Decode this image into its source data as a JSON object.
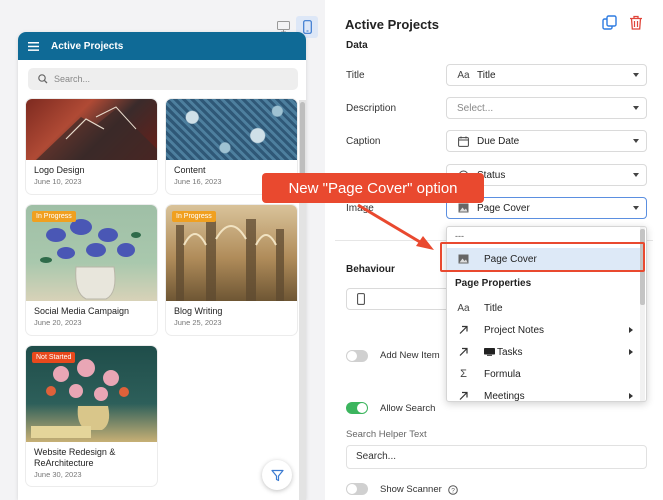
{
  "preview": {
    "app_title": "Active Projects",
    "search_placeholder": "Search...",
    "cards": [
      {
        "name": "Logo Design",
        "date": "June 10, 2023",
        "badge": ""
      },
      {
        "name": "Content",
        "date": "June 16, 2023",
        "badge": ""
      },
      {
        "name": "Social Media Campaign",
        "date": "June 20, 2023",
        "badge": "In Progress"
      },
      {
        "name": "Blog Writing",
        "date": "June 25, 2023",
        "badge": "In Progress"
      },
      {
        "name": "Website Redesign & ReArchitecture",
        "date": "June 30, 2023",
        "badge": "Not Started"
      }
    ],
    "badge_colors": {
      "in_progress": "#f0a020",
      "not_started": "#e8491d"
    }
  },
  "panel": {
    "title": "Active Projects",
    "data_section": "Data",
    "fields": [
      {
        "label": "Title",
        "value": "Title",
        "icon": "text-aa-icon"
      },
      {
        "label": "Description",
        "placeholder": "Select..."
      },
      {
        "label": "Caption",
        "value": "Due Date",
        "icon": "calendar-icon"
      },
      {
        "label": "",
        "value": "Status",
        "icon": "status-icon"
      },
      {
        "label": "Image",
        "value": "Page Cover",
        "icon": "image-icon"
      }
    ],
    "behaviour_section": "Behaviour",
    "add_new_item_label": "Add New Item",
    "allow_search_label": "Allow Search",
    "allow_search_on": true,
    "search_helper_label": "Search Helper Text",
    "search_helper_value": "Search...",
    "show_scanner_label": "Show Scanner"
  },
  "dropdown": {
    "separator": "---",
    "selected": "Page Cover",
    "group_heading": "Page Properties",
    "items": [
      {
        "label": "Title",
        "icon": "text-aa-icon",
        "submenu": false
      },
      {
        "label": "Project Notes",
        "icon": "relation-arrow-icon",
        "submenu": true
      },
      {
        "label": "Tasks",
        "icon": "relation-arrow-icon",
        "submenu": true
      },
      {
        "label": "Formula",
        "icon": "sigma-icon",
        "submenu": false
      },
      {
        "label": "Meetings",
        "icon": "relation-arrow-icon",
        "submenu": true
      }
    ]
  },
  "annotation": {
    "callout_text": "New \"Page Cover\" option",
    "color": "#e9492f"
  },
  "accent_color": "#0f6a96"
}
